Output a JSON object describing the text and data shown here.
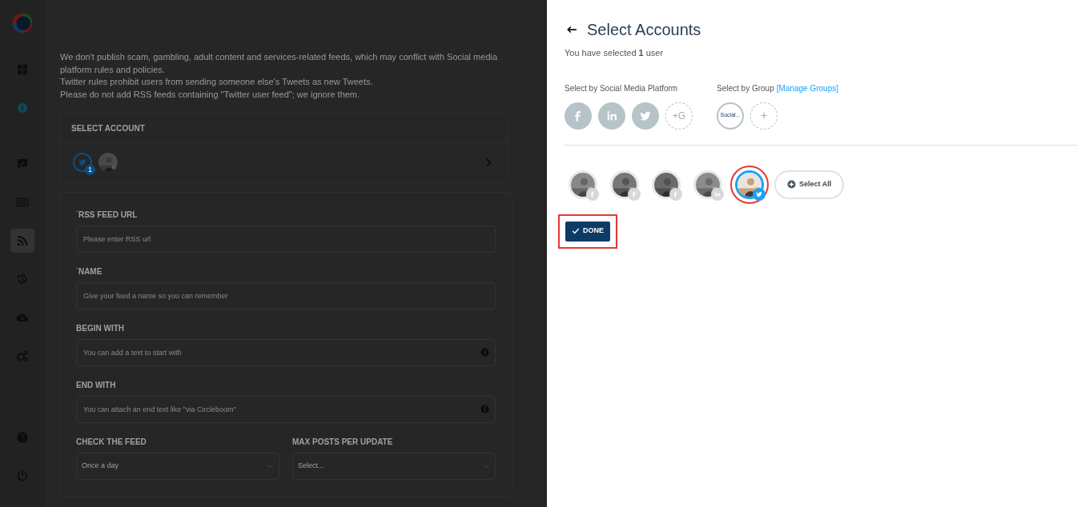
{
  "sidebar": {
    "items": [
      {
        "kind": "dashboard",
        "selected": false
      },
      {
        "kind": "badge",
        "selected": false
      },
      {
        "kind": "chat",
        "selected": false
      },
      {
        "kind": "list",
        "selected": false
      },
      {
        "kind": "rss",
        "selected": true
      },
      {
        "kind": "history",
        "selected": false
      },
      {
        "kind": "cloud",
        "selected": false
      },
      {
        "kind": "gears",
        "selected": false
      },
      {
        "kind": "help",
        "selected": false
      },
      {
        "kind": "power",
        "selected": false
      }
    ]
  },
  "notice": [
    "We don't publish scam, gambling, adult content and services-related feeds, which may conflict with Social media platform rules and policies.",
    "Twitter rules prohibit users from sending someone else's Tweets as new Tweets.",
    "Please do not add RSS feeds containing \"Twitter user feed\"; we ignore them."
  ],
  "select_account": {
    "label": "SELECT ACCOUNT",
    "count": "1"
  },
  "form": [
    {
      "label": "$^{*}$RSS FEED URL",
      "placeholder": "Please enter RSS url",
      "info": false
    },
    {
      "label": "$^{*}$NAME",
      "placeholder": "Give your feed a name so you can remember",
      "info": false
    },
    {
      "label": "BEGIN WITH",
      "placeholder": "You can add a text to start with",
      "info": true
    },
    {
      "label": "END WITH",
      "placeholder": "You can attach an end text like \"via Circleboom\"",
      "info": true
    }
  ],
  "form_selects": [
    {
      "label": "CHECK THE FEED",
      "value": "Once a day"
    },
    {
      "label": "MAX POSTS PER UPDATE",
      "value": "Select..."
    }
  ],
  "panel": {
    "title": "Select Accounts",
    "selected_text": "You have selected **1** user",
    "platform_label": "Select by Social Media Platform",
    "platforms": [
      {
        "kind": "facebook"
      },
      {
        "kind": "linkedin"
      },
      {
        "kind": "twitter"
      },
      {
        "kind": "add",
        "label": "+G"
      }
    ],
    "group_label": "Select by Group",
    "manage_link": "[Manage Groups]",
    "groups": [
      {
        "kind": "group",
        "label": "Social..."
      },
      {
        "kind": "add",
        "label": "+"
      }
    ],
    "accounts": [
      {
        "kind": "facebook",
        "selected": false,
        "highlighted": false
      },
      {
        "kind": "facebook",
        "selected": false,
        "highlighted": false
      },
      {
        "kind": "facebook",
        "selected": false,
        "highlighted": false
      },
      {
        "kind": "linkedin",
        "selected": false,
        "highlighted": false
      },
      {
        "kind": "twitter",
        "selected": true,
        "highlighted": true
      }
    ],
    "select_all": "Select All",
    "done": {
      "label": "DONE",
      "highlighted": true
    }
  }
}
